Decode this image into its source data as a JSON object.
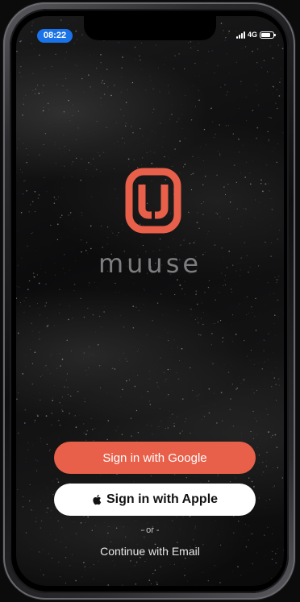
{
  "status_bar": {
    "time": "08:22",
    "network": "4G"
  },
  "brand": {
    "name": "muuse",
    "logo_icon": "muuse-logo-icon",
    "accent_color": "#e8604a"
  },
  "auth": {
    "google_label": "Sign in with Google",
    "apple_label": "Sign in with Apple",
    "divider_label": "- or -",
    "email_label": "Continue with Email"
  },
  "colors": {
    "google_button": "#e8604a",
    "apple_button": "#ffffff",
    "time_pill": "#1a73e8"
  }
}
